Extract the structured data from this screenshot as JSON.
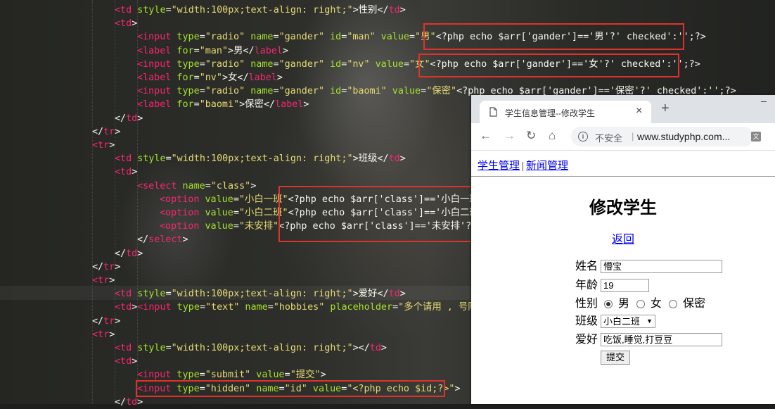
{
  "editor": {
    "lines": [
      {
        "segs": [
          [
            "t",
            "<td"
          ],
          [
            "a",
            " style"
          ],
          [
            "p",
            "="
          ],
          [
            "s",
            "\"width:100px;text-align: right;\""
          ],
          [
            "p",
            ">性别</"
          ],
          [
            "t",
            "td"
          ],
          [
            "p",
            ">"
          ]
        ]
      },
      {
        "segs": [
          [
            "t",
            "<td"
          ],
          [
            "p",
            ">"
          ]
        ]
      },
      {
        "segs": [
          [
            "t",
            "<input"
          ],
          [
            "a",
            " type"
          ],
          [
            "p",
            "="
          ],
          [
            "s",
            "\"radio\""
          ],
          [
            "a",
            " name"
          ],
          [
            "p",
            "="
          ],
          [
            "s",
            "\"gander\""
          ],
          [
            "a",
            " id"
          ],
          [
            "p",
            "="
          ],
          [
            "s",
            "\"man\""
          ],
          [
            "a",
            " value"
          ],
          [
            "p",
            "="
          ],
          [
            "s",
            "\"男\""
          ],
          [
            "p",
            "<?php echo $arr['gander']=='男'?' checked':'';?>"
          ]
        ]
      },
      {
        "segs": [
          [
            "t",
            "<label"
          ],
          [
            "a",
            " for"
          ],
          [
            "p",
            "="
          ],
          [
            "s",
            "\"man\""
          ],
          [
            "p",
            ">男</"
          ],
          [
            "t",
            "label"
          ],
          [
            "p",
            ">"
          ]
        ]
      },
      {
        "segs": [
          [
            "t",
            "<input"
          ],
          [
            "a",
            " type"
          ],
          [
            "p",
            "="
          ],
          [
            "s",
            "\"radio\""
          ],
          [
            "a",
            " name"
          ],
          [
            "p",
            "="
          ],
          [
            "s",
            "\"gander\""
          ],
          [
            "a",
            " id"
          ],
          [
            "p",
            "="
          ],
          [
            "s",
            "\"nv\""
          ],
          [
            "a",
            " value"
          ],
          [
            "p",
            "="
          ],
          [
            "s",
            "\"女\""
          ],
          [
            "p",
            "<?php echo $arr['gander']=='女'?' checked':'';?>"
          ]
        ]
      },
      {
        "segs": [
          [
            "t",
            "<label"
          ],
          [
            "a",
            " for"
          ],
          [
            "p",
            "="
          ],
          [
            "s",
            "\"nv\""
          ],
          [
            "p",
            ">女</"
          ],
          [
            "t",
            "label"
          ],
          [
            "p",
            ">"
          ]
        ]
      },
      {
        "segs": [
          [
            "t",
            "<input"
          ],
          [
            "a",
            " type"
          ],
          [
            "p",
            "="
          ],
          [
            "s",
            "\"radio\""
          ],
          [
            "a",
            " name"
          ],
          [
            "p",
            "="
          ],
          [
            "s",
            "\"gander\""
          ],
          [
            "a",
            " id"
          ],
          [
            "p",
            "="
          ],
          [
            "s",
            "\"baomi\""
          ],
          [
            "a",
            " value"
          ],
          [
            "p",
            "="
          ],
          [
            "s",
            "\"保密\""
          ],
          [
            "p",
            "<?php echo $arr['gander']=='保密'?' checked':'';?>"
          ]
        ]
      },
      {
        "segs": [
          [
            "t",
            "<label"
          ],
          [
            "a",
            " for"
          ],
          [
            "p",
            "="
          ],
          [
            "s",
            "\"baomi\""
          ],
          [
            "p",
            ">保密</"
          ],
          [
            "t",
            "label"
          ],
          [
            "p",
            ">"
          ]
        ]
      },
      {
        "segs": [
          [
            "p",
            "</"
          ],
          [
            "t",
            "td"
          ],
          [
            "p",
            ">"
          ]
        ]
      },
      {
        "segs": [
          [
            "p",
            "</"
          ],
          [
            "t",
            "tr"
          ],
          [
            "p",
            ">"
          ]
        ]
      },
      {
        "segs": [
          [
            "t",
            "<tr"
          ],
          [
            "p",
            ">"
          ]
        ]
      },
      {
        "segs": [
          [
            "t",
            "<td"
          ],
          [
            "a",
            " style"
          ],
          [
            "p",
            "="
          ],
          [
            "s",
            "\"width:100px;text-align: right;\""
          ],
          [
            "p",
            ">班级</"
          ],
          [
            "t",
            "td"
          ],
          [
            "p",
            ">"
          ]
        ]
      },
      {
        "segs": [
          [
            "t",
            "<td"
          ],
          [
            "p",
            ">"
          ]
        ]
      },
      {
        "segs": [
          [
            "t",
            "<select"
          ],
          [
            "a",
            " name"
          ],
          [
            "p",
            "="
          ],
          [
            "s",
            "\"class\""
          ],
          [
            "p",
            ">"
          ]
        ]
      },
      {
        "segs": [
          [
            "t",
            "<option"
          ],
          [
            "a",
            " value"
          ],
          [
            "p",
            "="
          ],
          [
            "s",
            "\"小白一班\""
          ],
          [
            "p",
            "<?php echo $arr['class']=='小白一班"
          ]
        ]
      },
      {
        "segs": [
          [
            "t",
            "<option"
          ],
          [
            "a",
            " value"
          ],
          [
            "p",
            "="
          ],
          [
            "s",
            "\"小白二班\""
          ],
          [
            "p",
            "<?php echo $arr['class']=='小白二班"
          ]
        ]
      },
      {
        "segs": [
          [
            "t",
            "<option"
          ],
          [
            "a",
            " value"
          ],
          [
            "p",
            "="
          ],
          [
            "s",
            "\"未安排\""
          ],
          [
            "p",
            "<?php echo $arr['class']=='未安排'?'"
          ]
        ]
      },
      {
        "segs": [
          [
            "p",
            "</"
          ],
          [
            "t",
            "select"
          ],
          [
            "p",
            ">"
          ]
        ]
      },
      {
        "segs": [
          [
            "p",
            "</"
          ],
          [
            "t",
            "td"
          ],
          [
            "p",
            ">"
          ]
        ]
      },
      {
        "segs": [
          [
            "p",
            "</"
          ],
          [
            "t",
            "tr"
          ],
          [
            "p",
            ">"
          ]
        ]
      },
      {
        "segs": [
          [
            "t",
            "<tr"
          ],
          [
            "p",
            ">"
          ]
        ]
      },
      {
        "segs": [
          [
            "t",
            "<td"
          ],
          [
            "a",
            " style"
          ],
          [
            "p",
            "="
          ],
          [
            "s",
            "\"width:100px;text-align: right;\""
          ],
          [
            "p",
            ">爱好</"
          ],
          [
            "t",
            "td"
          ],
          [
            "p",
            ">"
          ]
        ]
      },
      {
        "segs": [
          [
            "t",
            "<td"
          ],
          [
            "p",
            ">"
          ],
          [
            "t",
            "<input"
          ],
          [
            "a",
            " type"
          ],
          [
            "p",
            "="
          ],
          [
            "s",
            "\"text\""
          ],
          [
            "a",
            " name"
          ],
          [
            "p",
            "="
          ],
          [
            "s",
            "\"hobbies\""
          ],
          [
            "a",
            " placeholder"
          ],
          [
            "p",
            "="
          ],
          [
            "s",
            "\"多个请用 , 号隔开"
          ]
        ]
      },
      {
        "segs": [
          [
            "p",
            "</"
          ],
          [
            "t",
            "tr"
          ],
          [
            "p",
            ">"
          ]
        ]
      },
      {
        "segs": [
          [
            "t",
            "<tr"
          ],
          [
            "p",
            ">"
          ]
        ]
      },
      {
        "segs": [
          [
            "t",
            "<td"
          ],
          [
            "a",
            " style"
          ],
          [
            "p",
            "="
          ],
          [
            "s",
            "\"width:100px;text-align: right;\""
          ],
          [
            "p",
            "></"
          ],
          [
            "t",
            "td"
          ],
          [
            "p",
            ">"
          ]
        ]
      },
      {
        "segs": [
          [
            "t",
            "<td"
          ],
          [
            "p",
            ">"
          ]
        ]
      },
      {
        "segs": [
          [
            "t",
            "<input"
          ],
          [
            "a",
            " type"
          ],
          [
            "p",
            "="
          ],
          [
            "s",
            "\"submit\""
          ],
          [
            "a",
            " value"
          ],
          [
            "p",
            "="
          ],
          [
            "s",
            "\"提交\""
          ],
          [
            "p",
            ">"
          ]
        ]
      },
      {
        "segs": [
          [
            "t",
            "<input"
          ],
          [
            "a",
            " type"
          ],
          [
            "p",
            "="
          ],
          [
            "s",
            "\"hidden\""
          ],
          [
            "a",
            " name"
          ],
          [
            "p",
            "="
          ],
          [
            "s",
            "\"id\""
          ],
          [
            "a",
            " value"
          ],
          [
            "p",
            "="
          ],
          [
            "s",
            "\"<?php echo $id;?>\""
          ],
          [
            "p",
            ">"
          ]
        ]
      },
      {
        "segs": [
          [
            "p",
            "</"
          ],
          [
            "t",
            "td"
          ],
          [
            "p",
            ">"
          ]
        ]
      }
    ],
    "colors": {
      "tag": "#f92672",
      "attr": "#a6e22e",
      "string": "#e6db74",
      "plain": "#f8f8f2",
      "highlight_box": "#e0322c"
    }
  },
  "browser": {
    "tab_title": "学生信息管理--修改学生",
    "tab_close": "×",
    "new_tab": "+",
    "minimize": "–",
    "back_icon": "←",
    "forward_icon": "→",
    "reload_icon": "↻",
    "home_icon": "⌂",
    "info_icon": "i",
    "insecure_label": "不安全",
    "separator": "|",
    "url": "www.studyphp.com...",
    "translate_icon": "文",
    "nav": {
      "link1": "学生管理",
      "sep": "|",
      "link2": "新闻管理"
    },
    "page_title": "修改学生",
    "back_link": "返回",
    "form": {
      "name_label": "姓名",
      "name_value": "懵宝",
      "age_label": "年龄",
      "age_value": "19",
      "gender_label": "性别",
      "gender_options": [
        "男",
        "女",
        "保密"
      ],
      "gender_selected": "男",
      "class_label": "班级",
      "class_value": "小白二班",
      "select_arrow": "▼",
      "hobby_label": "爱好",
      "hobby_value": "吃饭,睡觉,打豆豆",
      "submit_label": "提交"
    }
  }
}
